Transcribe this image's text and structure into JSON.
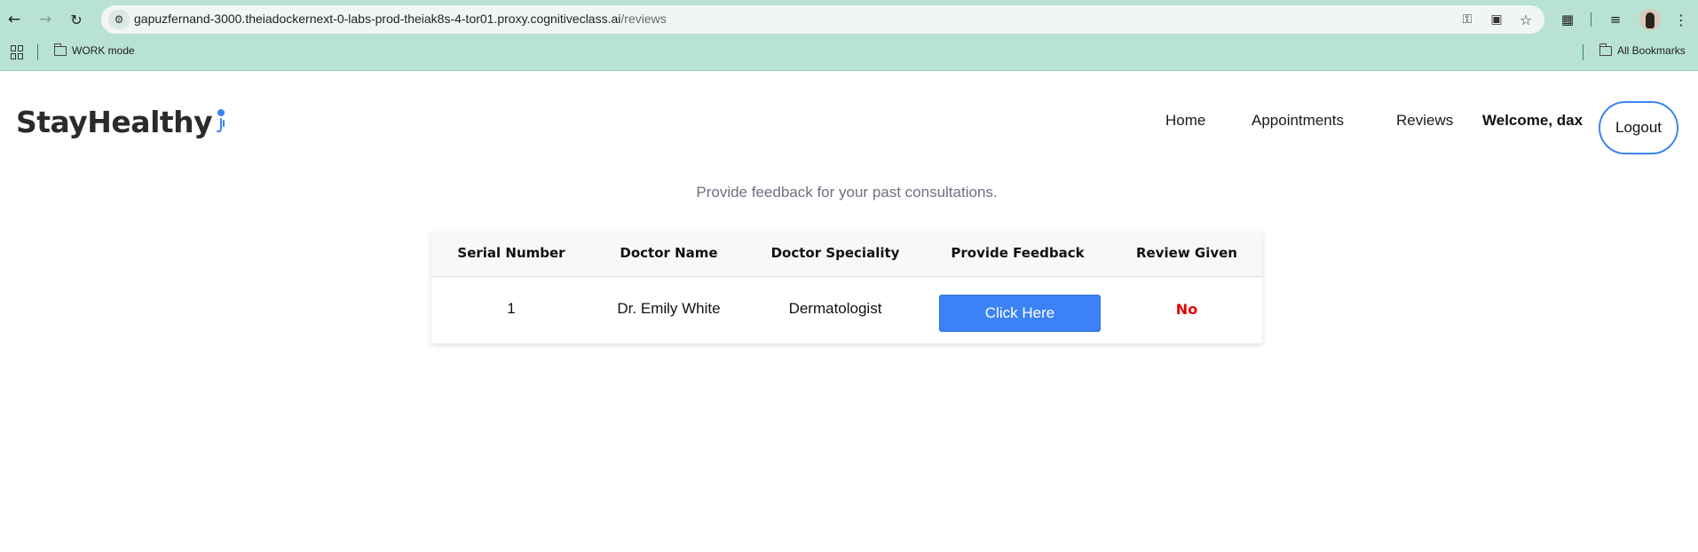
{
  "browser": {
    "url_host": "gapuzfernand-3000.theiadockernext-0-labs-prod-theiak8s-4-tor01.proxy.cognitiveclass.ai",
    "url_path": "/reviews",
    "bookmarks": [
      {
        "label": "WORK mode"
      },
      {
        "label": "All Bookmarks"
      }
    ],
    "accent_color": "#b8e2d4"
  },
  "header": {
    "logo": "StayHealthy",
    "nav": [
      {
        "label": "Home"
      },
      {
        "label": "Appointments"
      },
      {
        "label": "Reviews"
      }
    ],
    "welcome": "Welcome, dax",
    "logout_label": "Logout"
  },
  "main": {
    "subtitle": "Provide feedback for your past consultations.",
    "table": {
      "headers": [
        "Serial Number",
        "Doctor Name",
        "Doctor Speciality",
        "Provide Feedback",
        "Review Given"
      ],
      "rows": [
        {
          "serial": "1",
          "doctor": "Dr. Emily White",
          "speciality": "Dermatologist",
          "feedback_button": "Click Here",
          "review_given": "No"
        }
      ]
    },
    "colors": {
      "button": "#3b82f6",
      "review_no": "#e60000",
      "logout_border": "#3a86f0"
    }
  }
}
